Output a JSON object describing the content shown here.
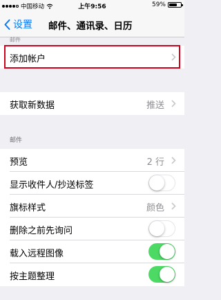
{
  "status_bar": {
    "carrier": "中国移动",
    "time": "上午9:56",
    "battery": "59%",
    "battery_level": 0.59
  },
  "nav": {
    "back_label": "设置",
    "title": "邮件、通讯录、日历"
  },
  "top_hint": "邮件",
  "add_account": {
    "label": "添加帐户"
  },
  "fetch": {
    "label": "获取新数据",
    "value": "推送"
  },
  "mail_header": "邮件",
  "rows": [
    {
      "label": "预览",
      "value": "2 行",
      "type": "disclosure"
    },
    {
      "label": "显示收件人/抄送标签",
      "type": "switch",
      "on": false
    },
    {
      "label": "旗标样式",
      "value": "颜色",
      "type": "disclosure"
    },
    {
      "label": "删除之前先询问",
      "type": "switch",
      "on": false
    },
    {
      "label": "载入远程图像",
      "type": "switch",
      "on": true
    },
    {
      "label": "按主题整理",
      "type": "switch",
      "on": true
    }
  ],
  "colors": {
    "accent": "#007aff",
    "switch_on": "#4cd964",
    "highlight": "#d0021b"
  }
}
